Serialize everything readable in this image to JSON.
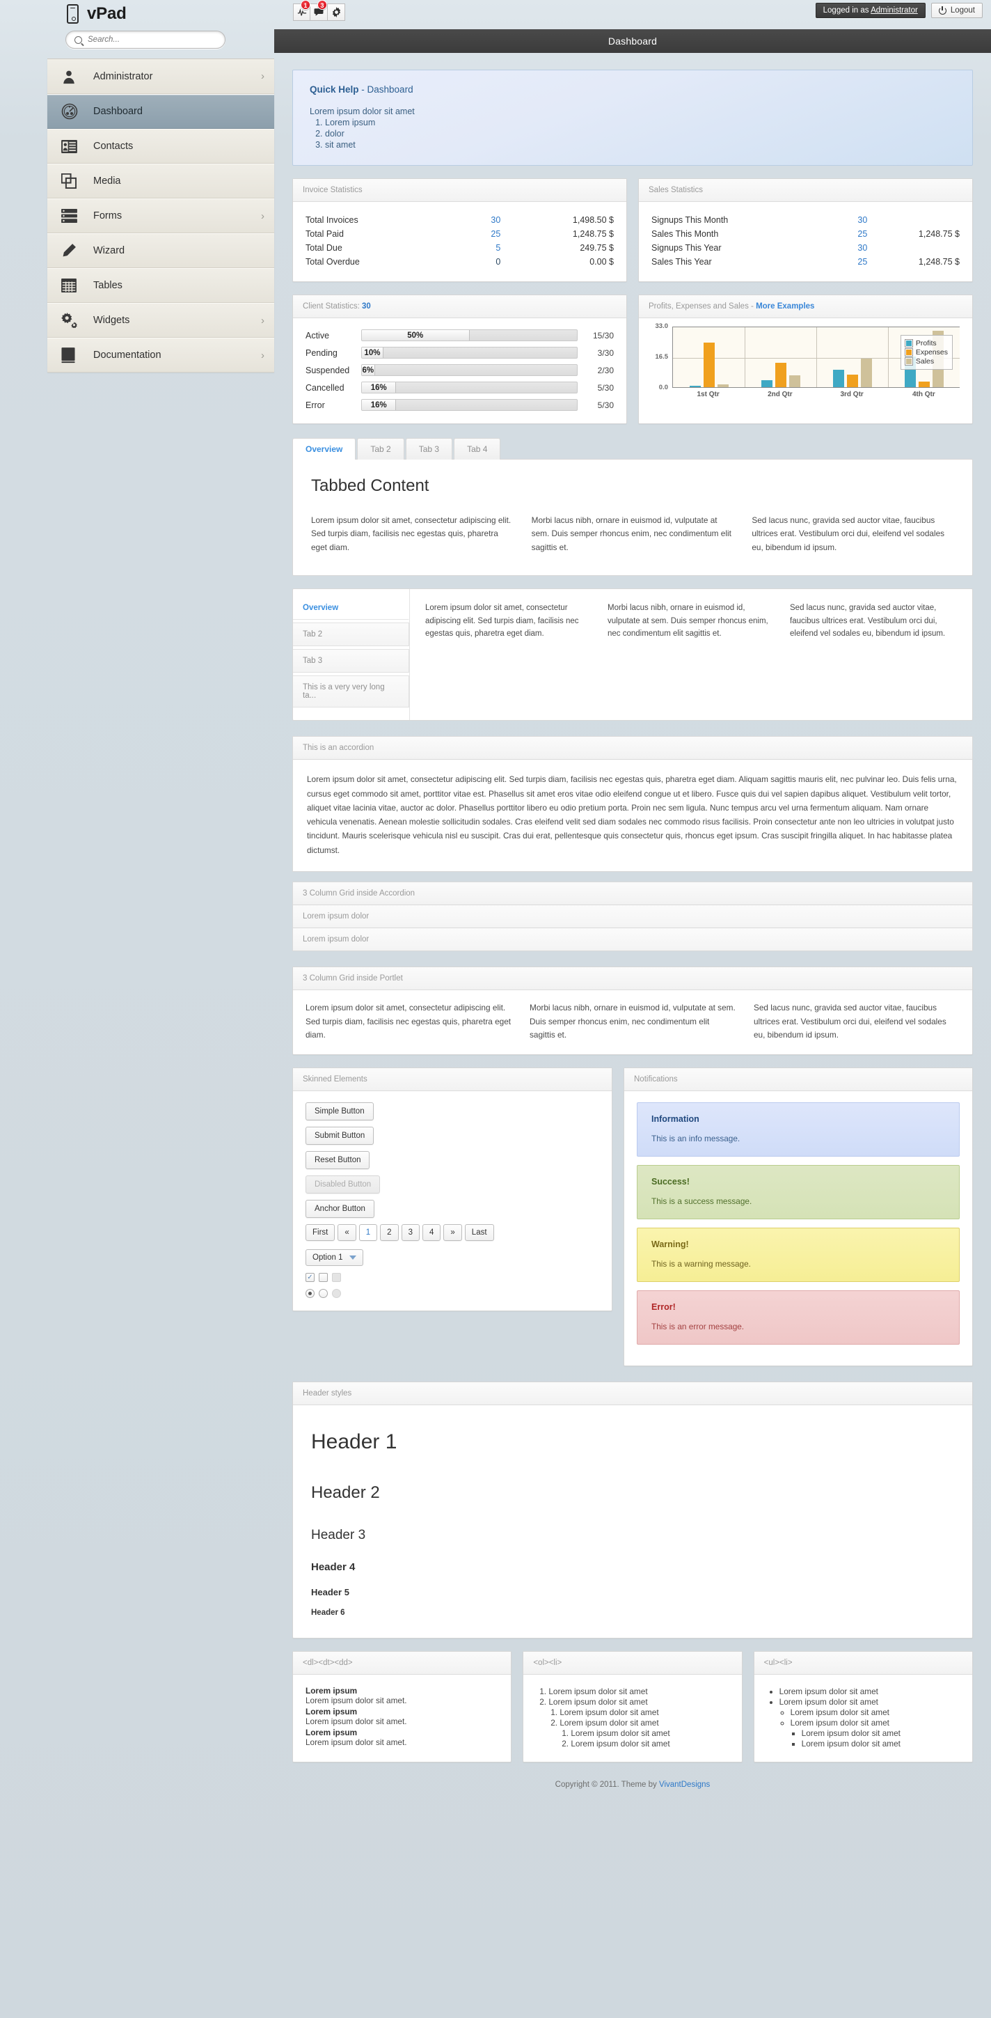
{
  "brand": {
    "name": "vPad",
    "icon": "phone-icon"
  },
  "search": {
    "placeholder": "Search...",
    "value": "",
    "icon": "search-icon"
  },
  "sidebar": {
    "items": [
      {
        "label": "Administrator",
        "icon": "user-icon",
        "arrow": "›",
        "active": false
      },
      {
        "label": "Dashboard",
        "icon": "gauge-icon",
        "arrow": "",
        "active": true
      },
      {
        "label": "Contacts",
        "icon": "contact-card-icon",
        "arrow": "",
        "active": false
      },
      {
        "label": "Media",
        "icon": "copy-icon",
        "arrow": "",
        "active": false
      },
      {
        "label": "Forms",
        "icon": "list-icon",
        "arrow": "›",
        "active": false
      },
      {
        "label": "Wizard",
        "icon": "pencil-icon",
        "arrow": "",
        "active": false
      },
      {
        "label": "Tables",
        "icon": "table-icon",
        "arrow": "",
        "active": false
      },
      {
        "label": "Widgets",
        "icon": "gears-icon",
        "arrow": "›",
        "active": false
      },
      {
        "label": "Documentation",
        "icon": "book-icon",
        "arrow": "›",
        "active": false
      }
    ]
  },
  "topbar": {
    "icons": [
      {
        "name": "activity-icon",
        "badge": "1"
      },
      {
        "name": "chat-icon",
        "badge": "3"
      },
      {
        "name": "gear-icon",
        "badge": ""
      }
    ],
    "logged_in_prefix": "Logged in as ",
    "logged_in_user": "Administrator",
    "logout_label": "Logout"
  },
  "main": {
    "title": "Dashboard"
  },
  "quick_help": {
    "title_strong": "Quick Help",
    "title_rest": " - Dashboard",
    "intro": "Lorem ipsum dolor sit amet",
    "items": [
      "Lorem ipsum",
      "dolor",
      "sit amet"
    ]
  },
  "invoice_stats": {
    "title": "Invoice Statistics",
    "rows": [
      {
        "label": "Total Invoices",
        "count": "30",
        "amount": "1,498.50 $"
      },
      {
        "label": "Total Paid",
        "count": "25",
        "amount": "1,248.75 $"
      },
      {
        "label": "Total Due",
        "count": "5",
        "amount": "249.75 $"
      },
      {
        "label": "Total Overdue",
        "count": "0",
        "amount": "0.00 $"
      }
    ]
  },
  "sales_stats": {
    "title": "Sales Statistics",
    "rows": [
      {
        "label": "Signups This Month",
        "count": "30",
        "amount": ""
      },
      {
        "label": "Sales This Month",
        "count": "25",
        "amount": "1,248.75 $"
      },
      {
        "label": "Signups This Year",
        "count": "30",
        "amount": ""
      },
      {
        "label": "Sales This Year",
        "count": "25",
        "amount": "1,248.75 $"
      }
    ]
  },
  "client_stats": {
    "title_label": "Client Statistics: ",
    "title_value": "30",
    "rows": [
      {
        "label": "Active",
        "percent": "50%",
        "pct": 50,
        "ratio": "15/30"
      },
      {
        "label": "Pending",
        "percent": "10%",
        "pct": 10,
        "ratio": "3/30"
      },
      {
        "label": "Suspended",
        "percent": "6%",
        "pct": 6,
        "ratio": "2/30"
      },
      {
        "label": "Cancelled",
        "percent": "16%",
        "pct": 16,
        "ratio": "5/30"
      },
      {
        "label": "Error",
        "percent": "16%",
        "pct": 16,
        "ratio": "5/30"
      }
    ]
  },
  "chart_panel": {
    "title": "Profits, Expenses and Sales - ",
    "link": "More Examples"
  },
  "chart_data": {
    "type": "bar",
    "title": "Profits, Expenses and Sales",
    "categories": [
      "1st Qtr",
      "2nd Qtr",
      "3rd Qtr",
      "4th Qtr"
    ],
    "series": [
      {
        "name": "Profits",
        "color": "#3fa9c4",
        "values": [
          0.6,
          3.8,
          9.3,
          16.4
        ]
      },
      {
        "name": "Expenses",
        "color": "#f0a01e",
        "values": [
          24.0,
          13.3,
          6.6,
          3.1
        ]
      },
      {
        "name": "Sales",
        "color": "#cfc19a",
        "values": [
          1.5,
          6.5,
          15.5,
          30.2
        ]
      }
    ],
    "ylim": [
      0,
      33
    ],
    "yticks": [
      "0.0",
      "16.5",
      "33.0"
    ],
    "xlabel": "",
    "ylabel": "",
    "grid": true,
    "legend_position": "top-right"
  },
  "tabs": {
    "items": [
      "Overview",
      "Tab 2",
      "Tab 3",
      "Tab 4"
    ],
    "active": "Overview",
    "heading": "Tabbed Content",
    "columns": [
      "Lorem ipsum dolor sit amet, consectetur adipiscing elit. Sed turpis diam, facilisis nec egestas quis, pharetra eget diam.",
      "Morbi lacus nibh, ornare in euismod id, vulputate at sem. Duis semper rhoncus enim, nec condimentum elit sagittis et.",
      "Sed lacus nunc, gravida sed auctor vitae, faucibus ultrices erat. Vestibulum orci dui, eleifend vel sodales eu, bibendum id ipsum."
    ]
  },
  "vtabs": {
    "items": [
      "Overview",
      "Tab 2",
      "Tab 3",
      "This is a very very long ta..."
    ],
    "active": "Overview",
    "columns": [
      "Lorem ipsum dolor sit amet, consectetur adipiscing elit. Sed turpis diam, facilisis nec egestas quis, pharetra eget diam.",
      "Morbi lacus nibh, ornare in euismod id, vulputate at sem. Duis semper rhoncus enim, nec condimentum elit sagittis et.",
      "Sed lacus nunc, gravida sed auctor vitae, faucibus ultrices erat. Vestibulum orci dui, eleifend vel sodales eu, bibendum id ipsum."
    ]
  },
  "accordion": {
    "title": "This is an accordion",
    "body": "Lorem ipsum dolor sit amet, consectetur adipiscing elit. Sed turpis diam, facilisis nec egestas quis, pharetra eget diam. Aliquam sagittis mauris elit, nec pulvinar leo. Duis felis urna, cursus eget commodo sit amet, porttitor vitae est. Phasellus sit amet eros vitae odio eleifend congue ut et libero. Fusce quis dui vel sapien dapibus aliquet. Vestibulum velit tortor, aliquet vitae lacinia vitae, auctor ac dolor. Phasellus porttitor libero eu odio pretium porta. Proin nec sem ligula. Nunc tempus arcu vel urna fermentum aliquam. Nam ornare vehicula venenatis. Aenean molestie sollicitudin sodales. Cras eleifend velit sed diam sodales nec commodo risus facilisis. Proin consectetur ante non leo ultricies in volutpat justo tincidunt. Mauris scelerisque vehicula nisl eu suscipit. Cras dui erat, pellentesque quis consectetur quis, rhoncus eget ipsum. Cras suscipit fringilla aliquet. In hac habitasse platea dictumst.",
    "grid_title": "3 Column Grid inside Accordion",
    "grid_rows": [
      "Lorem ipsum dolor",
      "Lorem ipsum dolor"
    ]
  },
  "portlet_grid": {
    "title": "3 Column Grid inside Portlet",
    "columns": [
      "Lorem ipsum dolor sit amet, consectetur adipiscing elit. Sed turpis diam, facilisis nec egestas quis, pharetra eget diam.",
      "Morbi lacus nibh, ornare in euismod id, vulputate at sem. Duis semper rhoncus enim, nec condimentum elit sagittis et.",
      "Sed lacus nunc, gravida sed auctor vitae, faucibus ultrices erat. Vestibulum orci dui, eleifend vel sodales eu, bibendum id ipsum."
    ]
  },
  "skinned": {
    "title": "Skinned Elements",
    "buttons": [
      "Simple Button",
      "Submit Button",
      "Reset Button",
      "Disabled Button",
      "Anchor Button"
    ],
    "pager": [
      "First",
      "«",
      "1",
      "2",
      "3",
      "4",
      "»",
      "Last"
    ],
    "pager_current": "1",
    "select_value": "Option 1",
    "checkbox_states": [
      "checked",
      "unchecked",
      "disabled"
    ],
    "radio_states": [
      "selected",
      "unselected",
      "disabled"
    ]
  },
  "notifications": {
    "title": "Notifications",
    "items": [
      {
        "type": "info",
        "heading": "Information",
        "message": "This is an info message."
      },
      {
        "type": "success",
        "heading": "Success!",
        "message": "This is a success message."
      },
      {
        "type": "warning",
        "heading": "Warning!",
        "message": "This is a warning message."
      },
      {
        "type": "error",
        "heading": "Error!",
        "message": "This is an error message."
      }
    ]
  },
  "header_styles": {
    "title": "Header styles",
    "h1": "Header 1",
    "h2": "Header 2",
    "h3": "Header 3",
    "h4": "Header 4",
    "h5": "Header 5",
    "h6": "Header 6"
  },
  "dl_panel": {
    "title": "<dl><dt><dd>",
    "pairs": [
      {
        "term": "Lorem ipsum",
        "desc": "Lorem ipsum dolor sit amet."
      },
      {
        "term": "Lorem ipsum",
        "desc": "Lorem ipsum dolor sit amet."
      },
      {
        "term": "Lorem ipsum",
        "desc": "Lorem ipsum dolor sit amet."
      }
    ]
  },
  "ol_panel": {
    "title": "<ol><li>",
    "items": [
      "Lorem ipsum dolor sit amet",
      "Lorem ipsum dolor sit amet"
    ],
    "sub": [
      "Lorem ipsum dolor sit amet",
      "Lorem ipsum dolor sit amet"
    ],
    "subsub": [
      "Lorem ipsum dolor sit amet",
      "Lorem ipsum dolor sit amet"
    ]
  },
  "ul_panel": {
    "title": "<ul><li>",
    "items": [
      "Lorem ipsum dolor sit amet",
      "Lorem ipsum dolor sit amet"
    ],
    "sub": [
      "Lorem ipsum dolor sit amet",
      "Lorem ipsum dolor sit amet"
    ],
    "subsub": [
      "Lorem ipsum dolor sit amet",
      "Lorem ipsum dolor sit amet"
    ]
  },
  "footer": {
    "text": "Copyright © 2011. Theme by ",
    "link": "VivantDesigns"
  }
}
